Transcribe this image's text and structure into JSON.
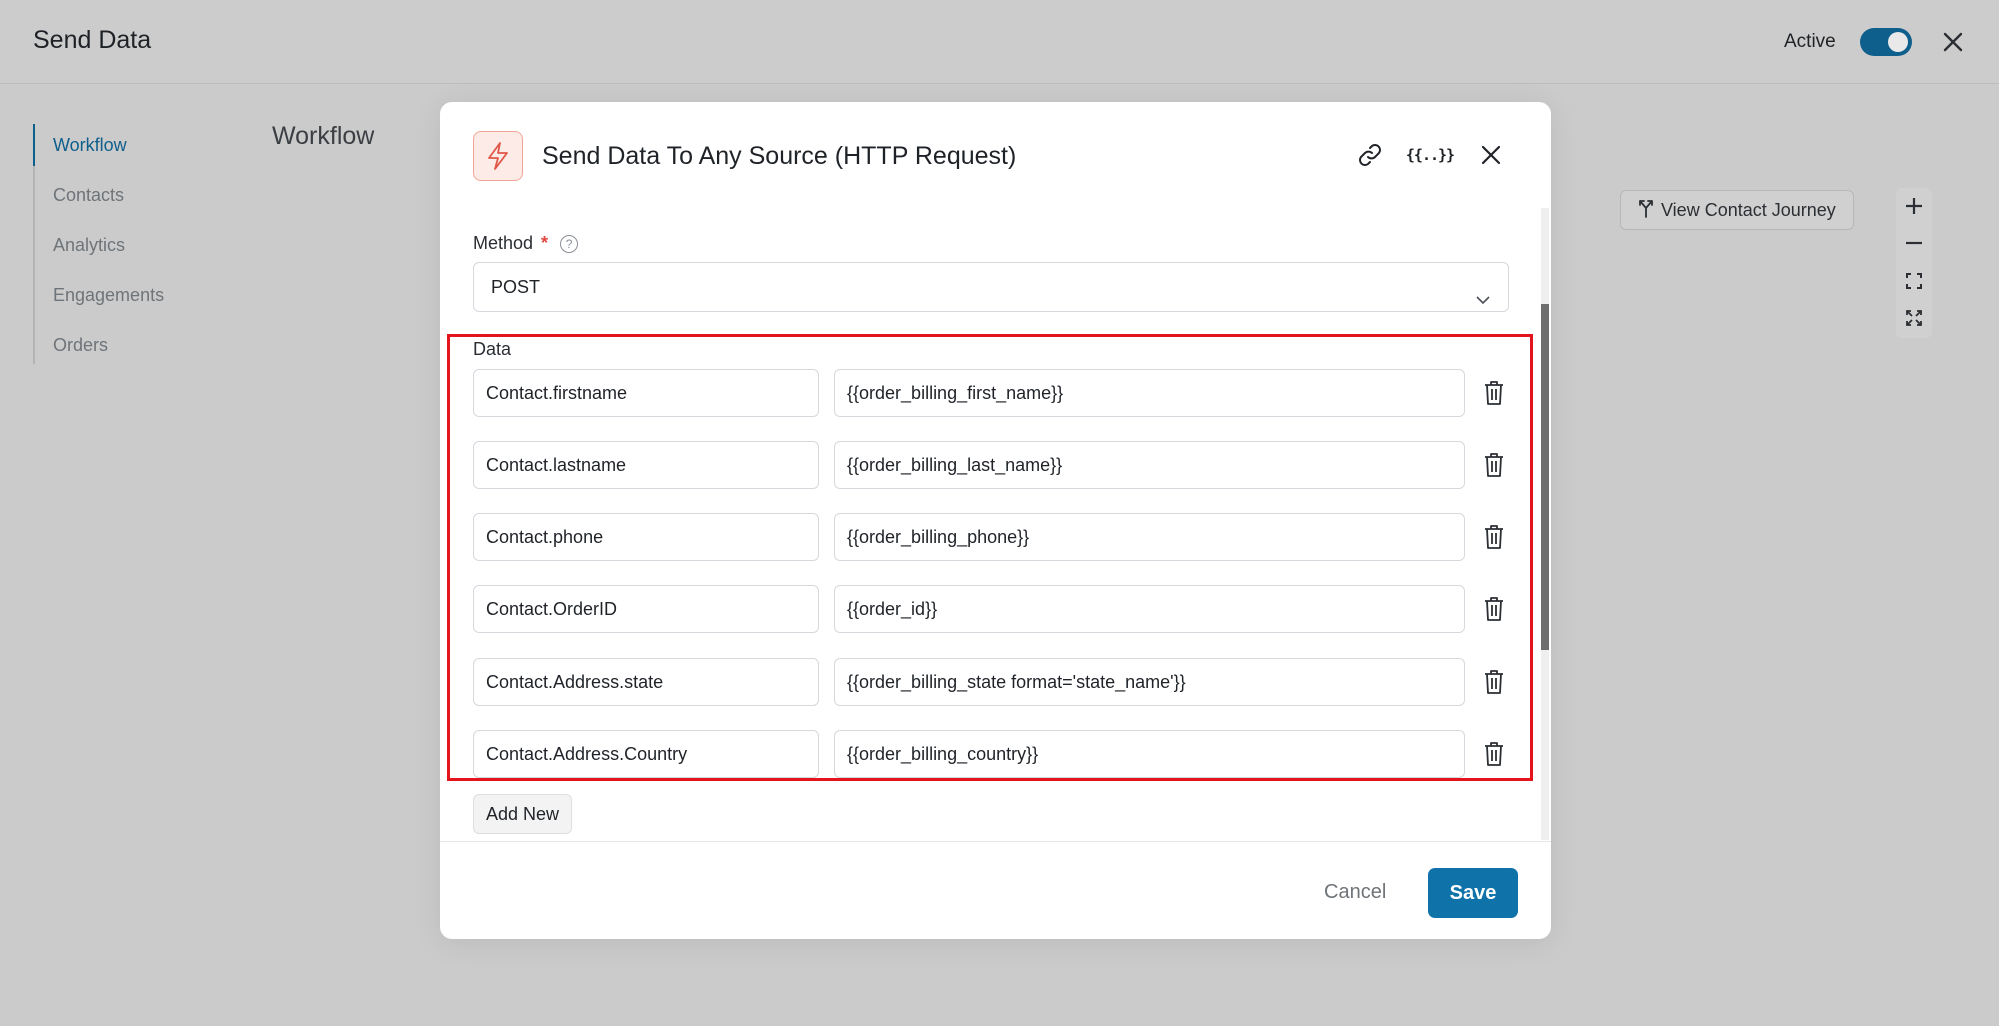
{
  "header": {
    "title": "Send Data",
    "active_label": "Active",
    "active_toggle_on": true
  },
  "sidebar": {
    "items": [
      {
        "label": "Workflow",
        "active": true
      },
      {
        "label": "Contacts"
      },
      {
        "label": "Analytics"
      },
      {
        "label": "Engagements"
      },
      {
        "label": "Orders"
      }
    ]
  },
  "canvas": {
    "title": "Workflow",
    "view_journey_label": "View Contact Journey",
    "zoom_controls": [
      "plus-icon",
      "minus-icon",
      "fit-screen-icon",
      "expand-icon"
    ]
  },
  "modal": {
    "title": "Send Data To Any Source (HTTP Request)",
    "icon": "bolt-icon",
    "header_icons": [
      "link-icon",
      "variables-icon",
      "close-icon"
    ],
    "variables_glyph": "{{..}}",
    "method": {
      "label": "Method",
      "required_mark": "*",
      "help_glyph": "?",
      "value": "POST"
    },
    "data": {
      "label": "Data",
      "rows": [
        {
          "key": "Contact.firstname",
          "value": "{{order_billing_first_name}}"
        },
        {
          "key": "Contact.lastname",
          "value": "{{order_billing_last_name}}"
        },
        {
          "key": "Contact.phone",
          "value": "{{order_billing_phone}}"
        },
        {
          "key": "Contact.OrderID",
          "value": "{{order_id}}"
        },
        {
          "key": "Contact.Address.state",
          "value": "{{order_billing_state format='state_name'}}"
        },
        {
          "key": "Contact.Address.Country",
          "value": "{{order_billing_country}}"
        }
      ],
      "add_new_label": "Add New"
    },
    "footer": {
      "cancel_label": "Cancel",
      "save_label": "Save"
    }
  },
  "colors": {
    "accent": "#0f73aa",
    "highlight_border": "#e3141b",
    "bolt": "#e0574a"
  }
}
